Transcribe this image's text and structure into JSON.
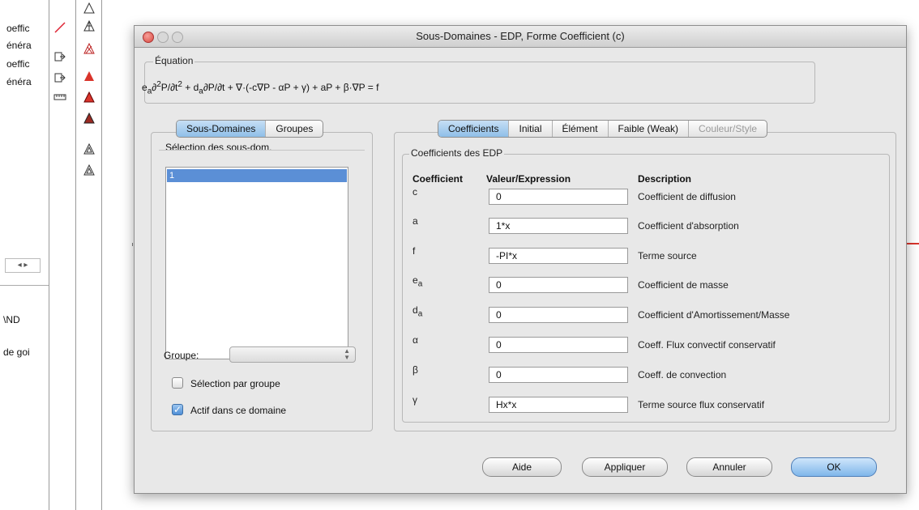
{
  "background": {
    "left_texts": [
      "oeffic",
      "énéra",
      "oeffic",
      "énéra"
    ],
    "lower_texts": [
      "\\ND",
      "de goi"
    ],
    "scroll_arrows": "◂ ▸"
  },
  "dialog": {
    "title": "Sous-Domaines - EDP, Forme Coefficient (c)",
    "equation_label": "Équation",
    "equation_html": "e<sub>a</sub>∂<sup>2</sup>P/∂t<sup>2</sup> + d<sub>a</sub>∂P/∂t + ∇·(-c∇P - αP + γ) + aP + β·∇P = f",
    "left_tabs": [
      "Sous-Domaines",
      "Groupes"
    ],
    "selection_label": "Sélection des sous-dom.",
    "subdomains": [
      "1"
    ],
    "groupe_label": "Groupe:",
    "groupe_value": "",
    "checkbox_group": "Sélection par groupe",
    "checkbox_active": "Actif dans ce domaine",
    "right_tabs": [
      "Coefficients",
      "Initial",
      "Élément",
      "Faible (Weak)",
      "Couleur/Style"
    ],
    "coeffs_group_label": "Coefficients des EDP",
    "headers": {
      "coef": "Coefficient",
      "value": "Valeur/Expression",
      "desc": "Description"
    },
    "rows": [
      {
        "coef": "c",
        "coef_html": "c",
        "value": "0",
        "desc": "Coefficient de diffusion"
      },
      {
        "coef": "a",
        "coef_html": "a",
        "value": "1*x",
        "desc": "Coefficient d'absorption"
      },
      {
        "coef": "f",
        "coef_html": "f",
        "value": "-PI*x",
        "desc": "Terme source"
      },
      {
        "coef": "ea",
        "coef_html": "e<sub>a</sub>",
        "value": "0",
        "desc": "Coefficient de masse"
      },
      {
        "coef": "da",
        "coef_html": "d<sub>a</sub>",
        "value": "0",
        "desc": "Coefficient d'Amortissement/Masse"
      },
      {
        "coef": "α",
        "coef_html": "α",
        "value": "0",
        "desc": "Coeff. Flux convectif conservatif"
      },
      {
        "coef": "β",
        "coef_html": "β",
        "value": "0",
        "desc": "Coeff. de convection"
      },
      {
        "coef": "γ",
        "coef_html": "γ",
        "value": "Hx*x",
        "desc": "Terme source flux conservatif"
      }
    ],
    "buttons": {
      "help": "Aide",
      "apply": "Appliquer",
      "cancel": "Annuler",
      "ok": "OK"
    }
  },
  "colors": {
    "accent": "#7fb6ea",
    "close": "#d9493f",
    "red_line": "#d9342b"
  }
}
